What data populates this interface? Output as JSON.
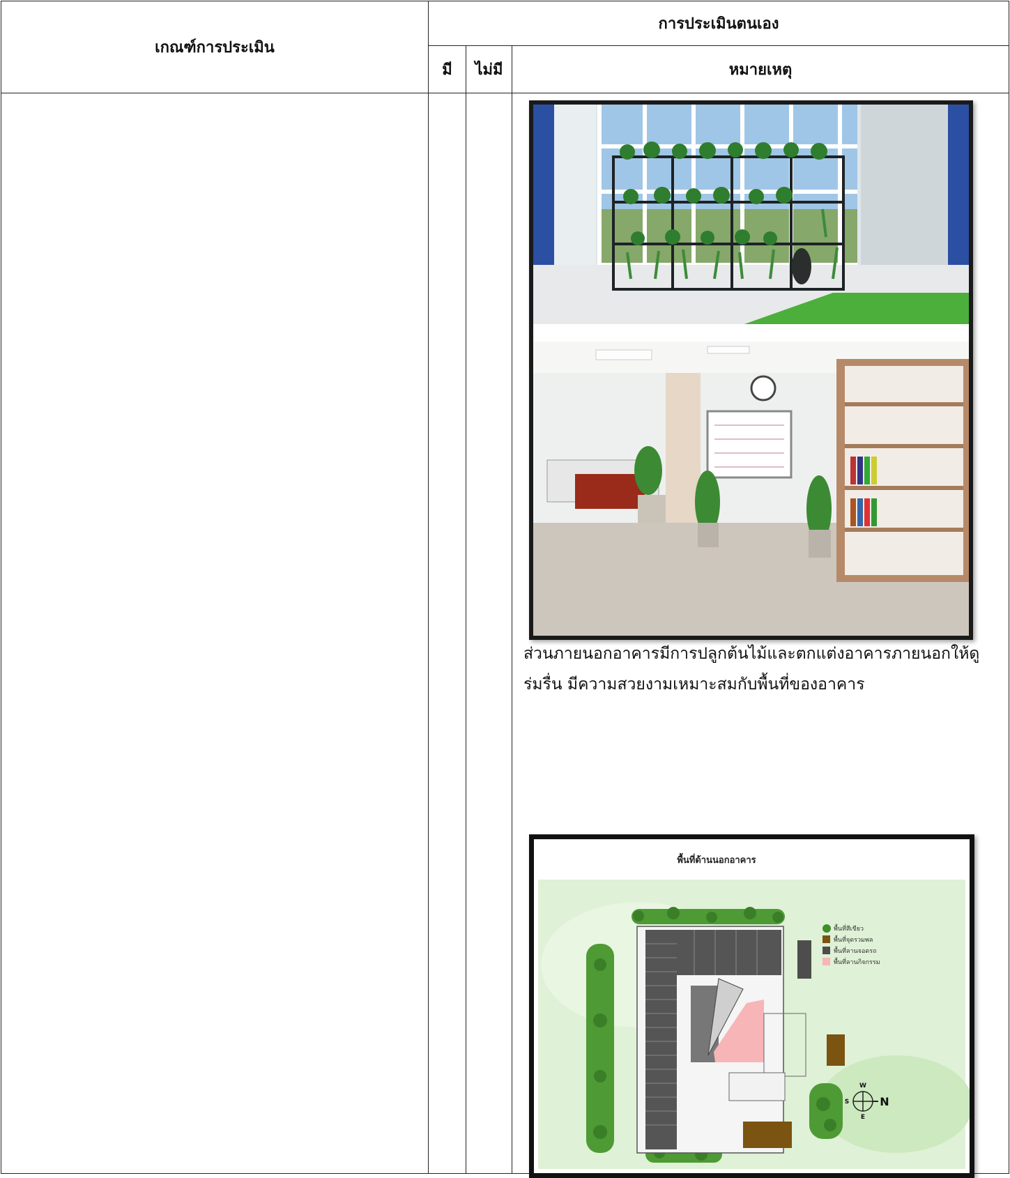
{
  "table": {
    "criteria_header": "เกณฑ์การประเมิน",
    "self_assess_header": "การประเมินตนเอง",
    "yes_header": "มี",
    "no_header": "ไม่มี",
    "remarks_header": "หมายเหตุ"
  },
  "remarks": {
    "note_text": "ส่วนภายนอกอาคารมีการปลูกต้นไม้และตกแต่งอาคารภายนอกให้ดูร่มรื่น มีความสวยงามเหมาะสมกับพื้นที่ของอาคาร",
    "map": {
      "title": "พื้นที่ด้านนอกอาคาร",
      "legend": {
        "green": "พื้นที่สีเขียว",
        "assembly": "พื้นที่จุดรวมพล",
        "parking": "พื้นที่ลานจอดรถ",
        "activity": "พื้นที่ลานกิจกรรม"
      },
      "compass": {
        "w": "W",
        "s": "S",
        "e": "E",
        "n": "N"
      },
      "colors": {
        "green": "#3f8f2a",
        "assembly": "#7a5410",
        "parking": "#4d4d4d",
        "activity": "#f7b5b8"
      }
    }
  }
}
